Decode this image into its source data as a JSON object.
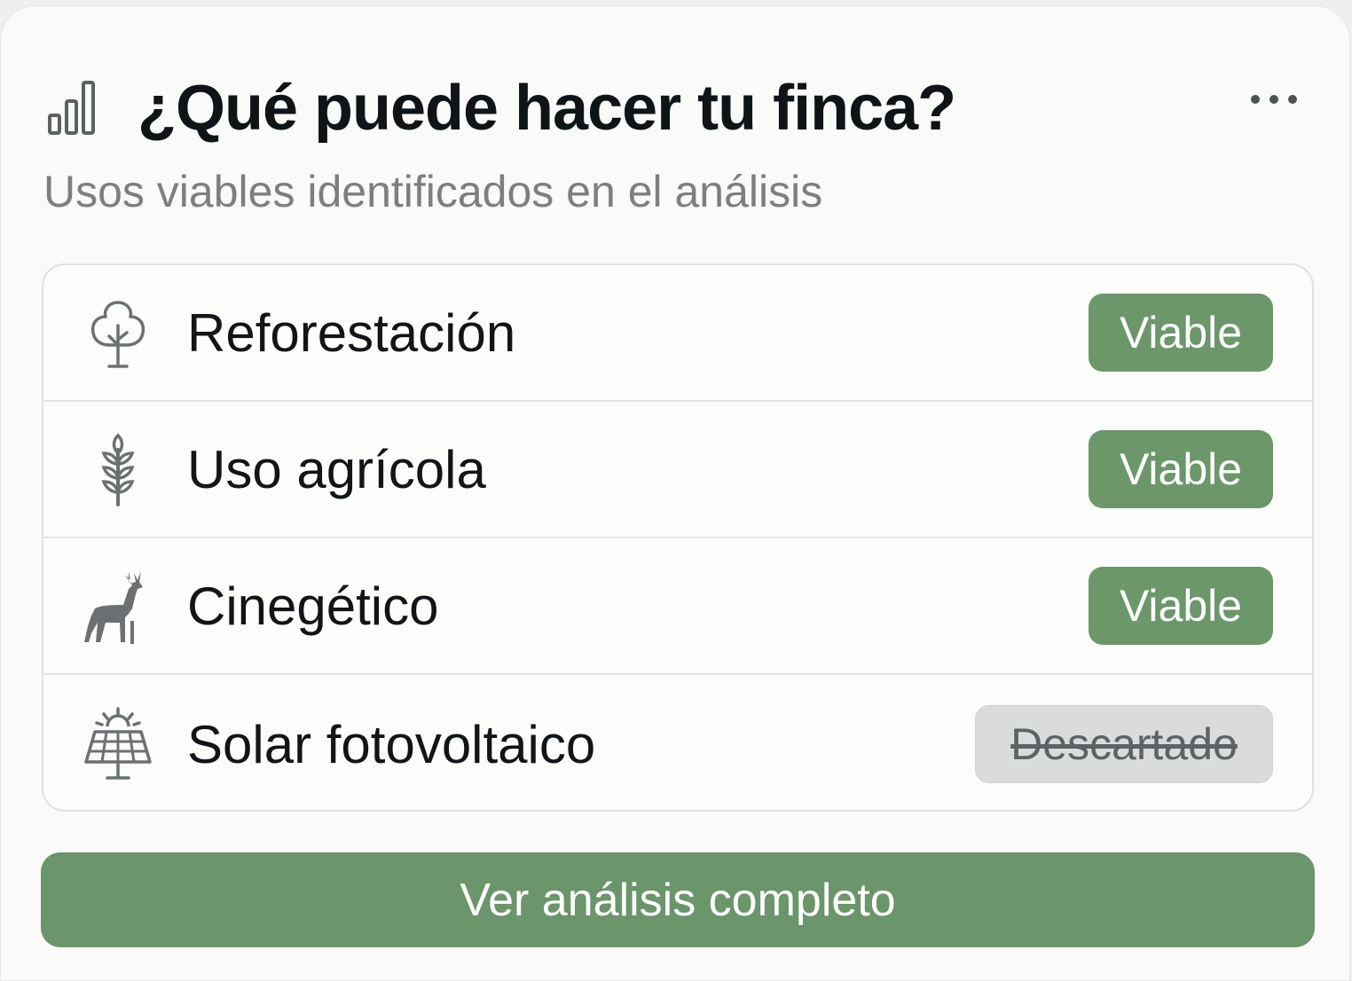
{
  "card": {
    "title": "¿Qué puede hacer tu finca?",
    "subtitle": "Usos viables identificados en el análisis",
    "header_icon": "bar-chart-icon",
    "menu_icon": "more-horizontal-icon"
  },
  "uses": [
    {
      "label": "Reforestación",
      "icon": "tree-icon",
      "status": "Viable"
    },
    {
      "label": "Uso agrícola",
      "icon": "wheat-icon",
      "status": "Viable"
    },
    {
      "label": "Cinegético",
      "icon": "deer-icon",
      "status": "Viable"
    },
    {
      "label": "Solar fotovoltaico",
      "icon": "solar-panel-icon",
      "status": "Descartado"
    }
  ],
  "cta": {
    "label": "Ver análisis completo"
  },
  "colors": {
    "viable": "#6b976b",
    "discarded_bg": "#dadcdc",
    "discarded_text": "#5e6264",
    "primary_button": "#6b956b"
  }
}
